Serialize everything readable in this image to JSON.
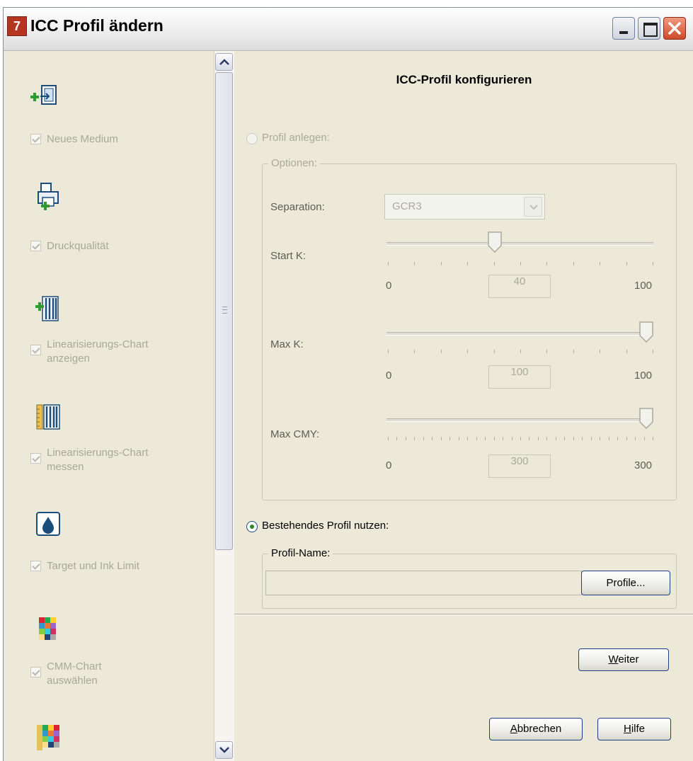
{
  "window": {
    "title": "ICC Profil ändern",
    "app_icon_text": "7",
    "controls": [
      "minimize-icon",
      "maximize-icon",
      "close-icon"
    ]
  },
  "sidebar": {
    "steps": [
      {
        "label": "Neues Medium",
        "icon": "new-media-icon"
      },
      {
        "label": "Druckqualität",
        "icon": "print-quality-icon"
      },
      {
        "label_lines": [
          "Linearisierungs-Chart",
          "anzeigen"
        ],
        "icon": "linearization-chart-show-icon"
      },
      {
        "label_lines": [
          "Linearisierungs-Chart",
          "messen"
        ],
        "icon": "linearization-chart-measure-icon"
      },
      {
        "label": "Target und Ink Limit",
        "icon": "ink-drop-icon"
      },
      {
        "label_lines": [
          "CMM-Chart",
          "auswählen"
        ],
        "icon": "cmm-chart-icon"
      },
      {
        "icon": "color-chart-icon"
      }
    ]
  },
  "main": {
    "heading": "ICC-Profil konfigurieren",
    "create_profile": {
      "label": "Profil anlegen:",
      "options_legend": "Optionen:",
      "separation_label": "Separation:",
      "separation_value": "GCR3",
      "sliders": [
        {
          "label": "Start K:",
          "min": "0",
          "max": "100",
          "value": "40",
          "fraction": 0.4
        },
        {
          "label": "Max K:",
          "min": "0",
          "max": "100",
          "value": "100",
          "fraction": 1.0
        },
        {
          "label": "Max CMY:",
          "min": "0",
          "max": "300",
          "value": "300",
          "fraction": 1.0
        }
      ]
    },
    "use_existing": {
      "label": "Bestehendes Profil nutzen:",
      "selected": true,
      "profile_name_legend": "Profil-Name:",
      "profile_name_value": "",
      "profiles_button": "Profile..."
    }
  },
  "buttons": {
    "next_mnemonic": "W",
    "next_rest": "eiter",
    "cancel_mnemonic": "A",
    "cancel_rest": "bbrechen",
    "help_mnemonic": "H",
    "help_rest": "ilfe"
  }
}
